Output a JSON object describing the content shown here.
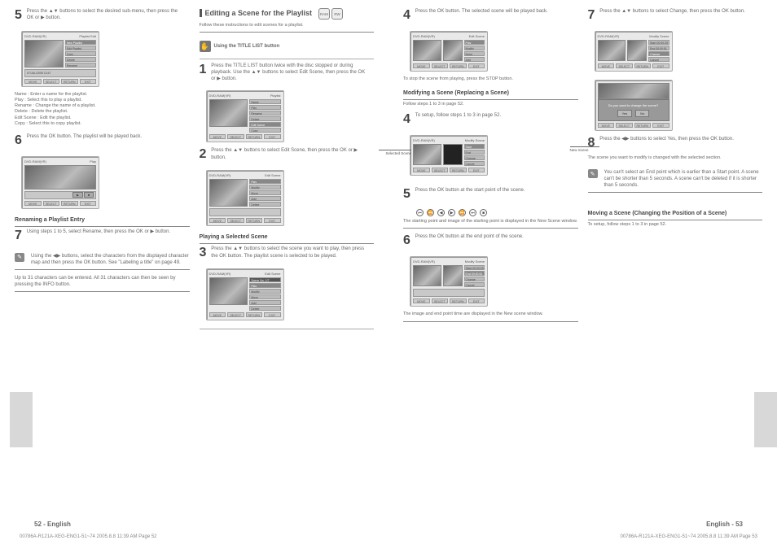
{
  "footer_left": "00786A-R121A-XEG-ENG1-51~74  2005.8.8  11:39 AM  Page 52",
  "footer_right": "00786A-R121A-XEG-ENG1-51~74  2005.8.8  11:39 AM  Page 53",
  "left_page_number": "52 - English",
  "right_page_number": "English - 53",
  "left": {
    "col1": {
      "step5": {
        "num": "5",
        "text": "Press the ▲▼ buttons to select the desired sub-menu, then press the OK or ▶ button.",
        "ui": {
          "header_left": "DVD-RAM(VR)",
          "header_right": "Playlist Edit",
          "rows": [
            "New Playlist",
            "Edit Playlist",
            "Copy",
            "Delete",
            "Rename",
            "Protection"
          ],
          "rows2": [
            "07/JUL/2005 13:47",
            "Screen"
          ],
          "fbtns": [
            "MOVE",
            "SELECT",
            "RETURN",
            "EXIT"
          ]
        },
        "bullets": [
          "Name : Enter a name for the playlist.",
          "Play : Select this to play a playlist.",
          "Rename : Change the name of a playlist.",
          "Delete : Delete the playlist.",
          "Edit Scene : Edit the playlist.",
          "Copy : Select this to copy playlist."
        ]
      },
      "step6": {
        "num": "6",
        "text": "Press the OK button. The playlist will be played back.",
        "ui": {
          "header_left": "DVD-RAM(VR)",
          "header_right": "Play",
          "fbtns": [
            "MOVE",
            "SELECT",
            "RETURN",
            "EXIT"
          ]
        }
      },
      "rename_title": "Renaming a Playlist Entry",
      "step7": {
        "num": "7",
        "text": "Using steps 1 to 5, select Rename, then press the OK or ▶ button."
      },
      "note": "Using the ◀▶ buttons, select the characters from the displayed character map and then press the OK button. See \"Labeling a title\" on page 49.",
      "note2": "Up to 31 characters can be entered. All 31 characters can then be seen by pressing the INFO button."
    },
    "col2": {
      "title": "Editing a Scene for the Playlist",
      "subtitle": "Follow these instructions to edit scenes for a playlist.",
      "hint": "Using the TITLE LIST button",
      "step1": {
        "num": "1",
        "text": "Press the TITLE LIST button twice with the disc stopped or during playback. Use the ▲▼ buttons to select Edit Scene, then press the OK or ▶ button.",
        "ui": {
          "header_left": "DVD-RAM(VR)",
          "header_right": "Playlist",
          "rows": [
            "Name",
            "Play",
            "Rename",
            "Delete",
            "Edit Scene",
            "Copy"
          ],
          "fbtns": [
            "MOVE",
            "SELECT",
            "RETURN",
            "EXIT"
          ]
        }
      },
      "step2": {
        "num": "2",
        "text": "Press the ▲▼ buttons to select Edit Scene, then press the OK or ▶ button.",
        "ui": {
          "header_left": "DVD-RAM(VR)",
          "header_right": "Edit Scene",
          "rows": [
            "Play",
            "Modify",
            "Move",
            "Add",
            "Delete"
          ],
          "fbtns": [
            "MOVE",
            "SELECT",
            "RETURN",
            "EXIT"
          ]
        }
      },
      "step3_title": "Playing a Selected Scene",
      "step3": {
        "num": "3",
        "text": "Press the ▲▼ buttons to select the scene you want to play, then press the OK button. The playlist scene is selected to be played.",
        "ui": {
          "header_left": "DVD-RAM(VR)",
          "header_right": "Edit Scene",
          "rows": [
            "Scene No. 1/7",
            "Play",
            "Modify",
            "Move",
            "Add",
            "Delete"
          ],
          "fbtns": [
            "MOVE",
            "SELECT",
            "RETURN",
            "EXIT"
          ]
        }
      }
    }
  },
  "right": {
    "col1": {
      "step4": {
        "num": "4",
        "text": "Press the OK button. The selected scene will be played back.",
        "ui": {
          "header_left": "DVD-RAM(VR)",
          "header_right": "Edit Scene",
          "rows": [
            "Scene No. 1/7",
            "Play",
            "Modify",
            "Move",
            "Add",
            "Delete"
          ],
          "fbtns": [
            "MOVE",
            "SELECT",
            "RETURN",
            "EXIT"
          ]
        },
        "note": "To stop the scene from playing, press the STOP button."
      },
      "modify_title": "Modifying a Scene (Replacing a Scene)",
      "modify_sub": "Follow steps 1 to 3 in page 52.",
      "step4b": {
        "num": "4",
        "text": "To setup, follow steps 1 to 3 in page 52.",
        "callout_left": "Selected Scene",
        "callout_right": "New Scene",
        "ui": {
          "header_left": "DVD-RAM(VR)",
          "header_right": "Modify Scene",
          "rows": [
            "Start",
            "End",
            "Change",
            "Cancel"
          ],
          "fbtns": [
            "MOVE",
            "SELECT",
            "RETURN",
            "EXIT"
          ]
        }
      },
      "step5b": {
        "num": "5",
        "text": "Press the OK button at the start point of the scene.",
        "circ_bar": "①②③④⑤⑥⑦",
        "note": "The starting point and image of the starting point is displayed in the New Scene window."
      },
      "step6b": {
        "num": "6",
        "text": "Press the OK button at the end point of the scene.",
        "ui": {
          "header_left": "DVD-RAM(VR)",
          "header_right": "Modify Scene",
          "rows": [
            "Start 00:00:25",
            "End 00:00:51",
            "Change",
            "Cancel"
          ],
          "fbtns": [
            "MOVE",
            "SELECT",
            "RETURN",
            "EXIT"
          ]
        },
        "note": "The image and end point time are displayed in the New scene window."
      }
    },
    "col2": {
      "step7": {
        "num": "7",
        "text": "Press the ▲▼ buttons to select Change, then press the OK button.",
        "ui1": {
          "header_left": "DVD-RAM(VR)",
          "header_right": "Modify Scene",
          "rows": [
            "Start 00:00:25",
            "End 00:00:51",
            "Change",
            "Cancel"
          ],
          "fbtns": [
            "MOVE",
            "SELECT",
            "RETURN",
            "EXIT"
          ]
        },
        "ui2_dialog": {
          "msg": "Do you want to change the scene?",
          "yes": "Yes",
          "no": "No"
        }
      },
      "step8": {
        "num": "8",
        "text": "Press the ◀▶ buttons to select Yes, then press the OK button.",
        "note": "The scene you want to modify is changed with the selected section."
      },
      "note_block": "You can't select an End point which is earlier than a Start point. A scene can't be shorter than 5 seconds. A scene can't be deleted if it is shorter than 5 seconds.",
      "move_title": "Moving a Scene (Changing the Position of a Scene)",
      "move_sub": "To setup, follow steps 1 to 3 in page 52."
    }
  },
  "ui_common": {
    "preview_label": "07/JUL/2005 13:47 PR"
  }
}
